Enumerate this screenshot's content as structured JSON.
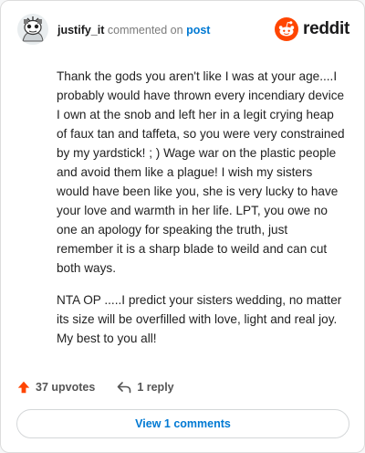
{
  "header": {
    "username": "justify_it",
    "action_text": "commented on",
    "post_link": "post",
    "logo_word": "reddit"
  },
  "comment": {
    "paragraphs": [
      "Thank the gods you aren't like I was at your age....I probably would have thrown every incendiary device I own at the snob and left her in a legit crying heap of faux tan and taffeta, so you were very constrained by my yardstick! ; ) Wage war on the plastic people and avoid them like a plague! I wish my sisters would have been like you, she is very lucky to have your love and warmth in her life. LPT, you owe no one an apology for speaking the truth, just remember it is a sharp blade to weild and can cut both ways.",
      "NTA OP .....I predict your sisters wedding, no matter its size will be overfilled with love, light and real joy. My best to you all!"
    ]
  },
  "footer": {
    "upvotes": "37 upvotes",
    "replies": "1 reply"
  },
  "view_button": "View 1 comments",
  "colors": {
    "reddit_orange": "#ff4500",
    "link_blue": "#0079d3"
  },
  "icons": {
    "avatar": "snoo-avatar-icon",
    "logo": "reddit-logo-icon",
    "upvote": "upvote-arrow-icon",
    "reply": "reply-arrow-icon"
  }
}
